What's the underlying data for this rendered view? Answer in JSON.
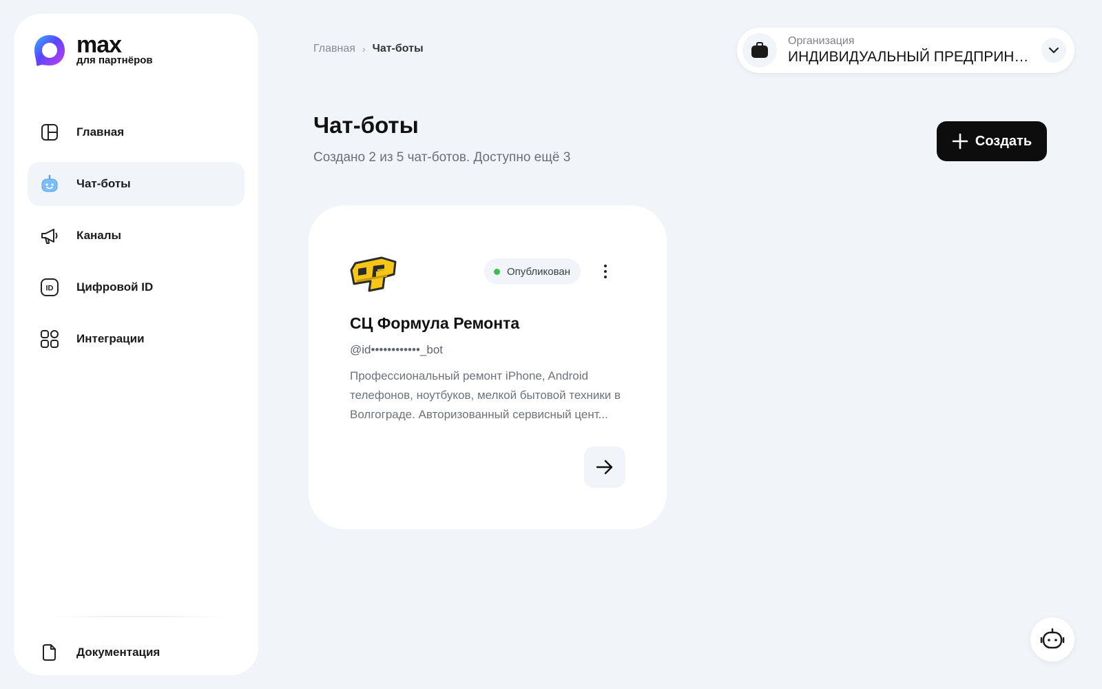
{
  "brand": {
    "word": "max",
    "subtitle": "для партнёров",
    "gradient": [
      "#3b6cff",
      "#8a3dff",
      "#e0409a"
    ]
  },
  "sidebar": {
    "items": [
      {
        "label": "Главная",
        "icon": "dashboard-icon",
        "active": false
      },
      {
        "label": "Чат-боты",
        "icon": "robot-icon",
        "active": true
      },
      {
        "label": "Каналы",
        "icon": "megaphone-icon",
        "active": false
      },
      {
        "label": "Цифровой ID",
        "icon": "id-card-icon",
        "active": false
      },
      {
        "label": "Интеграции",
        "icon": "apps-grid-icon",
        "active": false
      }
    ],
    "documentation": {
      "label": "Документация",
      "icon": "document-icon"
    }
  },
  "breadcrumb": {
    "home": "Главная",
    "separator": "›",
    "current": "Чат-боты"
  },
  "organization": {
    "label": "Организация",
    "value": "ИНДИВИДУАЛЬНЫЙ ПРЕДПРИНИ..."
  },
  "page": {
    "title": "Чат-боты",
    "subtitle": "Создано 2 из 5 чат-ботов. Доступно ещё 3",
    "create_label": "Создать"
  },
  "bots": [
    {
      "name": "СЦ Формула Ремонта",
      "handle": "@id••••••••••••_bot",
      "description": "Профессиональный ремонт iPhone, Android телефонов, ноутбуков, мелкой бытовой техники в Волгограде. Авторизованный сервисный цент...",
      "status": "Опубликован",
      "status_color": "#3ebd4f",
      "avatar_colors": [
        "#f5c518",
        "#2b2b2b"
      ]
    }
  ],
  "colors": {
    "background": "#f1f4f8",
    "accent_robot": "#4da3f5",
    "primary_button": "#0d0d0d"
  }
}
